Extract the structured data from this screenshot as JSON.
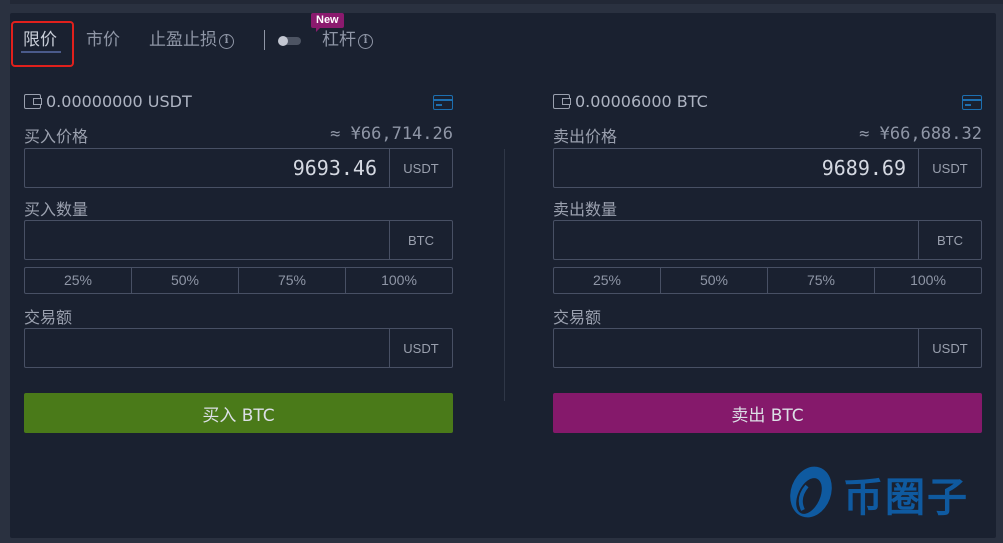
{
  "tabs": [
    {
      "label": "限价",
      "active": true
    },
    {
      "label": "市价",
      "active": false
    },
    {
      "label": "止盈止损",
      "active": false,
      "info": true
    },
    {
      "label": "杠杆",
      "active": false,
      "info": true,
      "badge": "New"
    }
  ],
  "leverage_toggle": {
    "on": false
  },
  "buy": {
    "balance": "0.00000000 USDT",
    "price_label": "买入价格",
    "price_approx": "≈ ¥66,714.26",
    "price_value": "9693.46",
    "price_unit": "USDT",
    "amount_label": "买入数量",
    "amount_value": "",
    "amount_unit": "BTC",
    "percents": [
      "25%",
      "50%",
      "75%",
      "100%"
    ],
    "total_label": "交易额",
    "total_value": "",
    "total_unit": "USDT",
    "button_label": "买入 BTC"
  },
  "sell": {
    "balance": "0.00006000 BTC",
    "price_label": "卖出价格",
    "price_approx": "≈ ¥66,688.32",
    "price_value": "9689.69",
    "price_unit": "USDT",
    "amount_label": "卖出数量",
    "amount_value": "",
    "amount_unit": "BTC",
    "percents": [
      "25%",
      "50%",
      "75%",
      "100%"
    ],
    "total_label": "交易额",
    "total_value": "",
    "total_unit": "USDT",
    "button_label": "卖出 BTC"
  },
  "colors": {
    "buy": "#4a7a19",
    "sell": "#85196b",
    "highlight": "#e0201c",
    "new_badge": "#8b1a6e",
    "accent_icon": "#1d6fb0"
  },
  "icons": {
    "wallet": "wallet-icon",
    "card": "card-icon",
    "info": "info-icon"
  },
  "watermark": {
    "text": "币圈子"
  }
}
